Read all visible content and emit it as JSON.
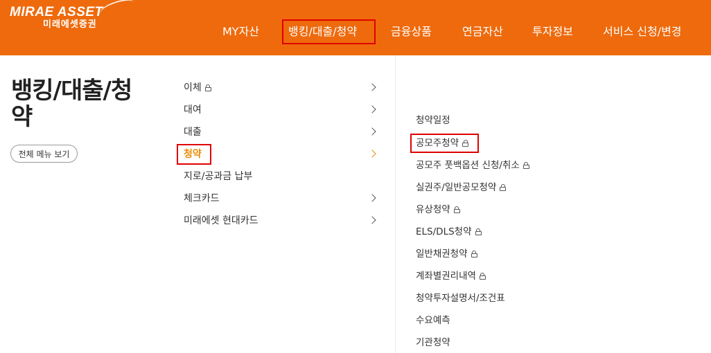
{
  "brand": {
    "logo_main": "MIRAE ASSET",
    "logo_sub": "미래에셋증권"
  },
  "gnb": [
    {
      "label": "MY자산"
    },
    {
      "label": "뱅킹/대출/청약",
      "selected": true
    },
    {
      "label": "금융상품"
    },
    {
      "label": "연금자산"
    },
    {
      "label": "투자정보"
    },
    {
      "label": "서비스 신청/변경"
    }
  ],
  "section": {
    "title": "뱅킹/대출/청약",
    "all_menu_label": "전체 메뉴 보기"
  },
  "submenu": [
    {
      "label": "이체",
      "lock": true,
      "has_children": true
    },
    {
      "label": "대여",
      "lock": false,
      "has_children": true
    },
    {
      "label": "대출",
      "lock": false,
      "has_children": true
    },
    {
      "label": "청약",
      "lock": false,
      "has_children": true,
      "active": true
    },
    {
      "label": "지로/공과금 납부",
      "lock": false,
      "has_children": false
    },
    {
      "label": "체크카드",
      "lock": false,
      "has_children": true
    },
    {
      "label": "미래에셋 현대카드",
      "lock": false,
      "has_children": true
    }
  ],
  "subsubmenu": [
    {
      "label": "청약일정",
      "lock": false
    },
    {
      "label": "공모주청약",
      "lock": true,
      "highlighted": true
    },
    {
      "label": "공모주 풋백옵션 신청/취소",
      "lock": true
    },
    {
      "label": "실권주/일반공모청약",
      "lock": true
    },
    {
      "label": "유상청약",
      "lock": true
    },
    {
      "label": "ELS/DLS청약",
      "lock": true
    },
    {
      "label": "일반채권청약",
      "lock": true
    },
    {
      "label": "계좌별권리내역",
      "lock": true
    },
    {
      "label": "청약투자설명서/조건표",
      "lock": false
    },
    {
      "label": "수요예측",
      "lock": false
    },
    {
      "label": "기관청약",
      "lock": false
    }
  ],
  "colors": {
    "brand_orange": "#ee6a0c",
    "active_text": "#ee8a00",
    "highlight_box": "#e00000"
  }
}
